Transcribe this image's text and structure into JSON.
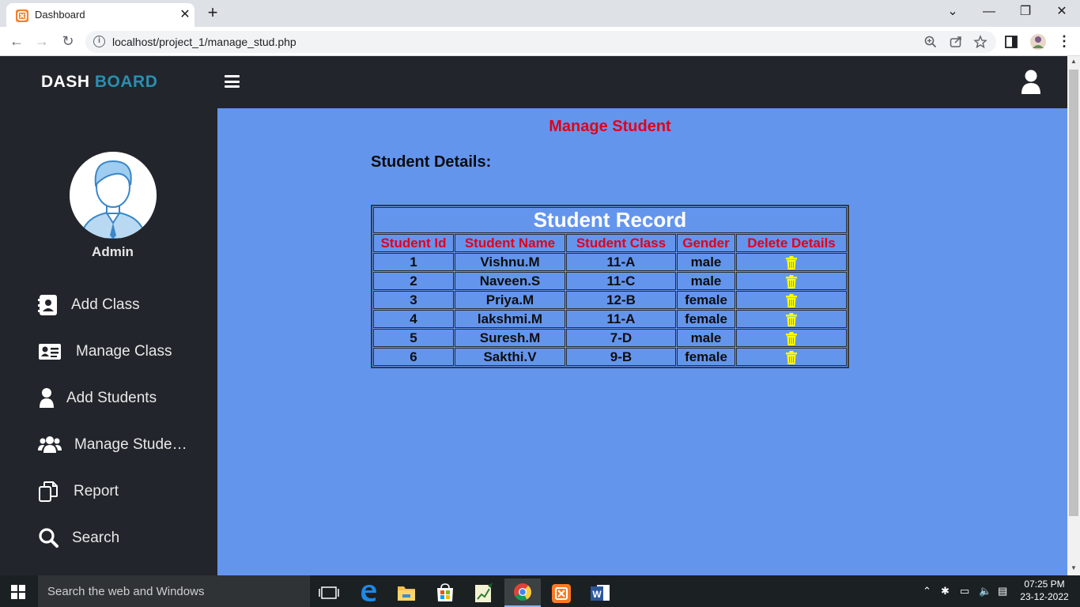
{
  "browser": {
    "tab_title": "Dashboard",
    "url": "localhost/project_1/manage_stud.php"
  },
  "header": {
    "brand_part1": "DASH",
    "brand_part2": "BOARD",
    "accent_color": "#2a8fb0"
  },
  "sidebar": {
    "profile_label": "Admin",
    "items": [
      {
        "label": "Add Class",
        "icon": "address-book-icon"
      },
      {
        "label": "Manage Class",
        "icon": "id-card-icon"
      },
      {
        "label": "Add Students",
        "icon": "user-icon"
      },
      {
        "label": "Manage Students",
        "icon": "users-icon"
      },
      {
        "label": "Report",
        "icon": "copy-icon"
      },
      {
        "label": "Search",
        "icon": "search-icon"
      }
    ]
  },
  "main": {
    "title": "Manage Student",
    "section_heading": "Student Details:",
    "table": {
      "caption": "Student Record",
      "columns": [
        "Student Id",
        "Student Name",
        "Student Class",
        "Gender",
        "Delete Details"
      ],
      "rows": [
        [
          "1",
          "Vishnu.M",
          "11-A",
          "male"
        ],
        [
          "2",
          "Naveen.S",
          "11-C",
          "male"
        ],
        [
          "3",
          "Priya.M",
          "12-B",
          "female"
        ],
        [
          "4",
          "lakshmi.M",
          "11-A",
          "female"
        ],
        [
          "5",
          "Suresh.M",
          "7-D",
          "male"
        ],
        [
          "6",
          "Sakthi.V",
          "9-B",
          "female"
        ]
      ]
    },
    "background_color": "#6495ed",
    "title_color": "#e3001b",
    "delete_icon_color": "#ffff00"
  },
  "taskbar": {
    "search_placeholder": "Search the web and Windows",
    "time": "07:25 PM",
    "date": "23-12-2022"
  }
}
